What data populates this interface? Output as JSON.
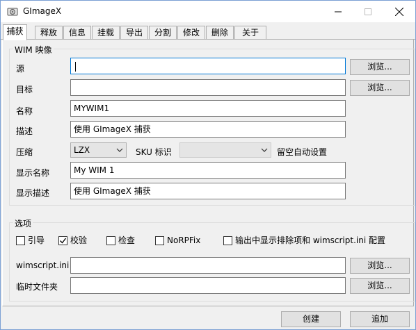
{
  "window": {
    "title": "GImageX"
  },
  "tabs": [
    "捕获",
    "释放",
    "信息",
    "挂载",
    "导出",
    "分割",
    "修改",
    "删除",
    "关于"
  ],
  "wim_group": {
    "title": "WIM 映像",
    "source": {
      "label": "源",
      "value": "",
      "browse": "浏览..."
    },
    "target": {
      "label": "目标",
      "value": "",
      "browse": "浏览..."
    },
    "name": {
      "label": "名称",
      "value": "MYWIM1"
    },
    "description": {
      "label": "描述",
      "value": "使用 GImageX 捕获"
    },
    "compression": {
      "label": "压缩",
      "value": "LZX"
    },
    "sku": {
      "label": "SKU 标识",
      "value": ""
    },
    "oobe": {
      "label": "留空自动设置"
    },
    "display_name": {
      "label": "显示名称",
      "value": "My WIM 1"
    },
    "display_desc": {
      "label": "显示描述",
      "value": "使用 GImageX 捕获"
    }
  },
  "options_group": {
    "title": "选项",
    "checkboxes": [
      {
        "label": "引导",
        "checked": false
      },
      {
        "label": "校验",
        "checked": true
      },
      {
        "label": "检查",
        "checked": false
      },
      {
        "label": "NoRPFix",
        "checked": false
      },
      {
        "label": "输出中显示排除项和 wimscript.ini 配置",
        "checked": false
      }
    ],
    "wimscript": {
      "label": "wimscript.ini",
      "value": "",
      "browse": "浏览..."
    },
    "tempdir": {
      "label": "临时文件夹",
      "value": "",
      "browse": "浏览..."
    }
  },
  "actions": {
    "create": "创建",
    "append": "追加"
  },
  "colors": {
    "focus_border": "#0078d7",
    "accent": "#0078d7"
  }
}
